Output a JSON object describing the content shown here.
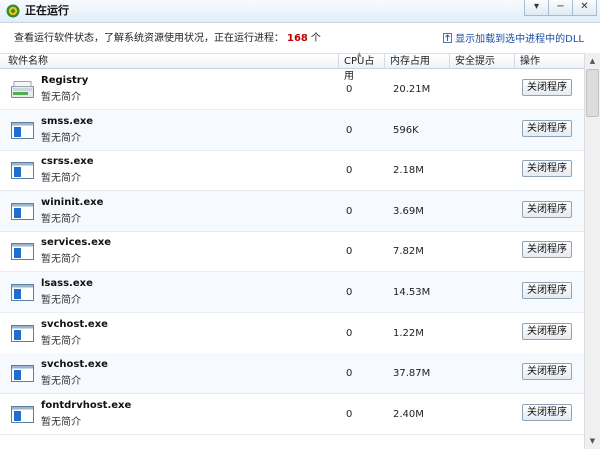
{
  "window": {
    "title": "正在运行",
    "buttons": [
      "▾",
      "−",
      "✕"
    ]
  },
  "info": {
    "prefix": "查看运行软件状态，了解系统资源使用状况，正在运行进程：",
    "count": "168",
    "suffix": "个",
    "dll_link": "显示加载到选中进程中的DLL"
  },
  "columns": {
    "name": "软件名称",
    "cpu": "CPU占用",
    "memory": "内存占用",
    "security": "安全提示",
    "action": "操作"
  },
  "processes": [
    {
      "name": "Registry",
      "desc": "暂无简介",
      "cpu": "0",
      "memory": "20.21M",
      "button": "关闭程序",
      "icon": "registry-icon"
    },
    {
      "name": "smss.exe",
      "desc": "暂无简介",
      "cpu": "0",
      "memory": "596K",
      "button": "关闭程序",
      "icon": "window-app-icon"
    },
    {
      "name": "csrss.exe",
      "desc": "暂无简介",
      "cpu": "0",
      "memory": "2.18M",
      "button": "关闭程序",
      "icon": "window-app-icon"
    },
    {
      "name": "wininit.exe",
      "desc": "暂无简介",
      "cpu": "0",
      "memory": "3.69M",
      "button": "关闭程序",
      "icon": "window-app-icon"
    },
    {
      "name": "services.exe",
      "desc": "暂无简介",
      "cpu": "0",
      "memory": "7.82M",
      "button": "关闭程序",
      "icon": "window-app-icon"
    },
    {
      "name": "lsass.exe",
      "desc": "暂无简介",
      "cpu": "0",
      "memory": "14.53M",
      "button": "关闭程序",
      "icon": "window-app-icon"
    },
    {
      "name": "svchost.exe",
      "desc": "暂无简介",
      "cpu": "0",
      "memory": "1.22M",
      "button": "关闭程序",
      "icon": "window-app-icon"
    },
    {
      "name": "svchost.exe",
      "desc": "暂无简介",
      "cpu": "0",
      "memory": "37.87M",
      "button": "关闭程序",
      "icon": "window-app-icon"
    },
    {
      "name": "fontdrvhost.exe",
      "desc": "暂无简介",
      "cpu": "0",
      "memory": "2.40M",
      "button": "关闭程序",
      "icon": "window-app-icon"
    }
  ],
  "colors": {
    "accent": "#1a4ea8",
    "count": "#c00000",
    "row_alt": "#f6fafe"
  }
}
